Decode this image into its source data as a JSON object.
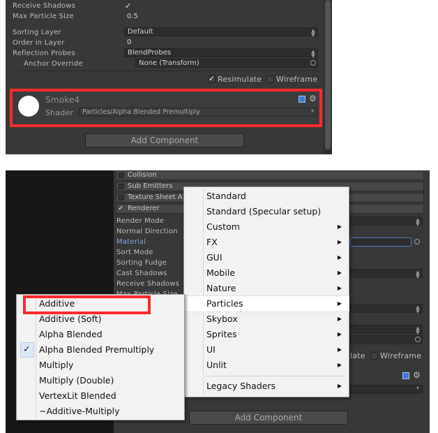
{
  "top_inspector": {
    "rows": [
      {
        "label": "Receive Shadows",
        "value": "✓"
      },
      {
        "label": "Max Particle Size",
        "value": "0.5"
      },
      {
        "label": "Sorting Layer",
        "value": "Default"
      },
      {
        "label": "Order in Layer",
        "value": "0"
      },
      {
        "label": "Reflection Probes",
        "value": "BlendProbes"
      },
      {
        "label": "Anchor Override",
        "value": "None (Transform)"
      }
    ],
    "resimulate_label": "Resimulate",
    "wireframe_label": "Wireframe",
    "material_name": "Smoke4",
    "shader_label": "Shader",
    "shader_value": "Particles/Alpha Blended Premultiply",
    "add_component_label": "Add Component"
  },
  "bottom_inspector": {
    "modules": [
      "Collision",
      "Sub Emitters",
      "Texture Sheet A",
      "Renderer"
    ],
    "renderer_check": "✓",
    "renderer_props": [
      "Render Mode",
      "Normal Direction",
      "Material",
      "Sort Mode",
      "Sorting Fudge",
      "Cast Shadows",
      "Receive Shadows",
      "Max Particle Size"
    ],
    "wireframe_label": "Wireframe",
    "resimulate_partial": "late",
    "add_component_label": "Add Component"
  },
  "shader_menu": {
    "items": [
      {
        "label": "Standard",
        "submenu": false
      },
      {
        "label": "Standard (Specular setup)",
        "submenu": false
      },
      {
        "label": "Custom",
        "submenu": true
      },
      {
        "label": "FX",
        "submenu": true
      },
      {
        "label": "GUI",
        "submenu": true
      },
      {
        "label": "Mobile",
        "submenu": true
      },
      {
        "label": "Nature",
        "submenu": true
      },
      {
        "label": "Particles",
        "submenu": true
      },
      {
        "label": "Skybox",
        "submenu": true
      },
      {
        "label": "Sprites",
        "submenu": true
      },
      {
        "label": "UI",
        "submenu": true
      },
      {
        "label": "Unlit",
        "submenu": true
      },
      {
        "label": "Legacy Shaders",
        "submenu": true
      }
    ],
    "arrow_glyph": "▶"
  },
  "particles_submenu": {
    "items": [
      "Additive",
      "Additive (Soft)",
      "Alpha Blended",
      "Alpha Blended Premultiply",
      "Multiply",
      "Multiply (Double)",
      "VertexLit Blended",
      "~Additive-Multiply"
    ],
    "checked_glyph": "✓",
    "checked_item": "Alpha Blended Premultiply"
  },
  "colors": {
    "highlight_red": "#ff2a2a",
    "inspector_bg": "#383838",
    "menu_bg": "#f2f2f2",
    "material_label_blue": "#7fa6e6"
  },
  "icons": [
    "check-icon",
    "dropdown-arrows-icon",
    "object-picker-icon",
    "help-book-icon",
    "gear-icon",
    "submenu-arrow-icon"
  ]
}
